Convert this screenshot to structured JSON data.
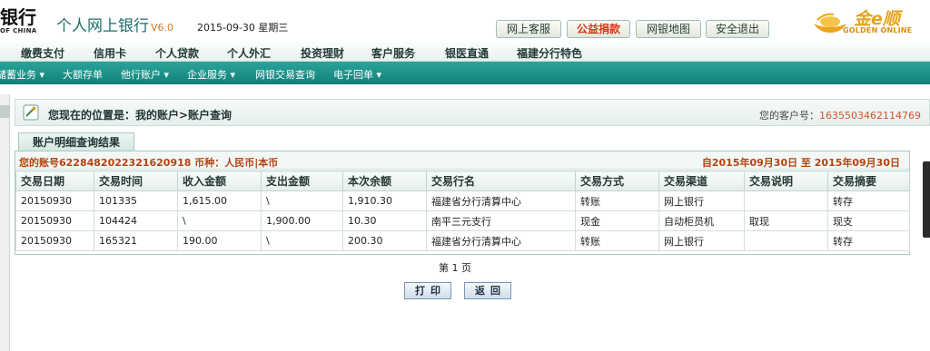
{
  "header": {
    "bank_name": "银行",
    "bank_sub": "OF CHINA",
    "product_title": "个人网上银行",
    "version": "V6.0",
    "date_text": "2015-09-30 星期三",
    "buttons": [
      "网上客服",
      "公益捐款",
      "网银地图",
      "安全退出"
    ],
    "golden_logo": {
      "word": "金e顺",
      "sub": "GOLDEN ONLINE"
    }
  },
  "main_nav": [
    "缴费支付",
    "信用卡",
    "个人贷款",
    "个人外汇",
    "投资理财",
    "客户服务",
    "银医直通",
    "福建分行特色"
  ],
  "sub_nav": [
    "储蓄业务 ▾",
    "大额存单",
    "他行账户 ▾",
    "企业服务 ▾",
    "网银交易查询",
    "电子回单 ▾"
  ],
  "location": {
    "text": "您现在的位置是：我的账户>账户查询",
    "customer_label": "您的客户号：",
    "customer_no": "1635503462114769"
  },
  "result": {
    "tab_title": "账户明细查询结果",
    "account_line": "您的账号6228482022321620918 币种：人民币|本币",
    "date_range": "自2015年09月30日  至  2015年09月30日",
    "columns": [
      "交易日期",
      "交易时间",
      "收入金额",
      "支出金额",
      "本次余额",
      "交易行名",
      "交易方式",
      "交易渠道",
      "交易说明",
      "交易摘要"
    ],
    "rows": [
      [
        "20150930",
        "101335",
        "1,615.00",
        "\\",
        "1,910.30",
        "福建省分行清算中心",
        "转账",
        "网上银行",
        "",
        "转存"
      ],
      [
        "20150930",
        "104424",
        "\\",
        "1,900.00",
        "10.30",
        "南平三元支行",
        "现金",
        "自动柜员机",
        "取现",
        "现支"
      ],
      [
        "20150930",
        "165321",
        "190.00",
        "\\",
        "200.30",
        "福建省分行清算中心",
        "转账",
        "网上银行",
        "",
        "转存"
      ]
    ],
    "pager": "第 1 页",
    "print_button": "打印",
    "back_button": "返回"
  },
  "colors": {
    "teal_nav": "#1a8f86",
    "accent_orange": "#d2562a",
    "account_text": "#b5420f"
  }
}
